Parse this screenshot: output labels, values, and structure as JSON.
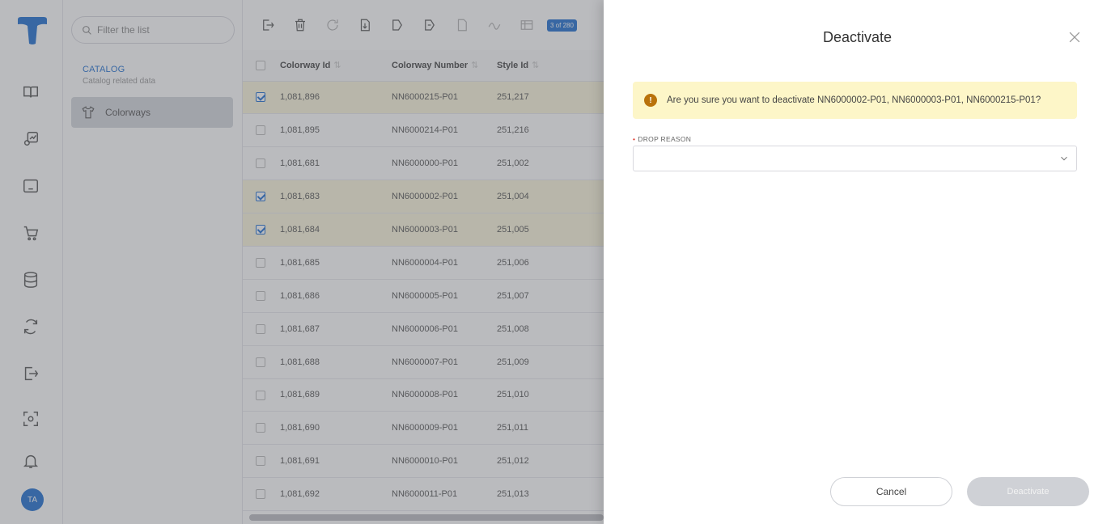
{
  "rail": {
    "avatar_initials": "TA",
    "brand_color": "#1f6fd1"
  },
  "nav": {
    "filter_placeholder": "Filter the list",
    "catalog_title": "CATALOG",
    "catalog_subtitle": "Catalog related data",
    "active_item": "Colorways"
  },
  "grid": {
    "selection_badge": "3 of 280",
    "columns": [
      "Colorway Id",
      "Colorway Number",
      "Style Id"
    ],
    "rows": [
      {
        "id": "1,081,896",
        "number": "NN6000215-P01",
        "style": "251,217",
        "selected": true
      },
      {
        "id": "1,081,895",
        "number": "NN6000214-P01",
        "style": "251,216",
        "selected": false
      },
      {
        "id": "1,081,681",
        "number": "NN6000000-P01",
        "style": "251,002",
        "selected": false
      },
      {
        "id": "1,081,683",
        "number": "NN6000002-P01",
        "style": "251,004",
        "selected": true
      },
      {
        "id": "1,081,684",
        "number": "NN6000003-P01",
        "style": "251,005",
        "selected": true
      },
      {
        "id": "1,081,685",
        "number": "NN6000004-P01",
        "style": "251,006",
        "selected": false
      },
      {
        "id": "1,081,686",
        "number": "NN6000005-P01",
        "style": "251,007",
        "selected": false
      },
      {
        "id": "1,081,687",
        "number": "NN6000006-P01",
        "style": "251,008",
        "selected": false
      },
      {
        "id": "1,081,688",
        "number": "NN6000007-P01",
        "style": "251,009",
        "selected": false
      },
      {
        "id": "1,081,689",
        "number": "NN6000008-P01",
        "style": "251,010",
        "selected": false
      },
      {
        "id": "1,081,690",
        "number": "NN6000009-P01",
        "style": "251,011",
        "selected": false
      },
      {
        "id": "1,081,691",
        "number": "NN6000010-P01",
        "style": "251,012",
        "selected": false
      },
      {
        "id": "1,081,692",
        "number": "NN6000011-P01",
        "style": "251,013",
        "selected": false
      }
    ]
  },
  "dialog": {
    "title": "Deactivate",
    "warning": "Are you sure you want to deactivate NN6000002-P01, NN6000003-P01, NN6000215-P01?",
    "drop_reason_label": "DROP REASON",
    "drop_reason_value": "",
    "cancel_label": "Cancel",
    "deactivate_label": "Deactivate"
  }
}
